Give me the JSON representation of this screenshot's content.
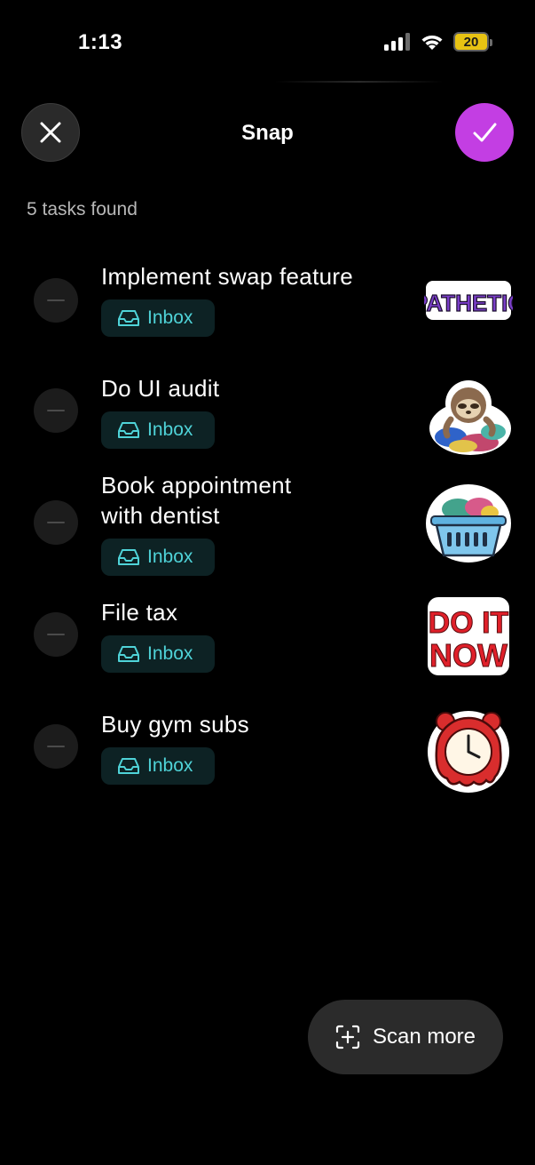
{
  "status_bar": {
    "time": "1:13",
    "battery": "20"
  },
  "header": {
    "title": "Snap"
  },
  "tasks_count": "5 tasks found",
  "tasks": [
    {
      "title": "Implement swap feature",
      "list": "Inbox",
      "sticker": "pathetic-sticker"
    },
    {
      "title": "Do UI audit",
      "list": "Inbox",
      "sticker": "sloth-laundry-sticker"
    },
    {
      "title": "Book appointment with dentist",
      "list": "Inbox",
      "sticker": "laundry-basket-sticker"
    },
    {
      "title": "File tax",
      "list": "Inbox",
      "sticker": "do-it-now-sticker"
    },
    {
      "title": "Buy gym subs",
      "list": "Inbox",
      "sticker": "melting-alarm-clock-sticker"
    }
  ],
  "stickers": {
    "pathetic_text": "PATHETIC",
    "do_it_now_line1": "DO IT",
    "do_it_now_line2": "NOW"
  },
  "scan_button": {
    "label": "Scan more"
  },
  "colors": {
    "background": "#000000",
    "accent": "#c33ee3",
    "inbox_text": "#4fd3d8",
    "inbox_bg": "#0d2224",
    "muted_text": "#b7b7b7"
  }
}
